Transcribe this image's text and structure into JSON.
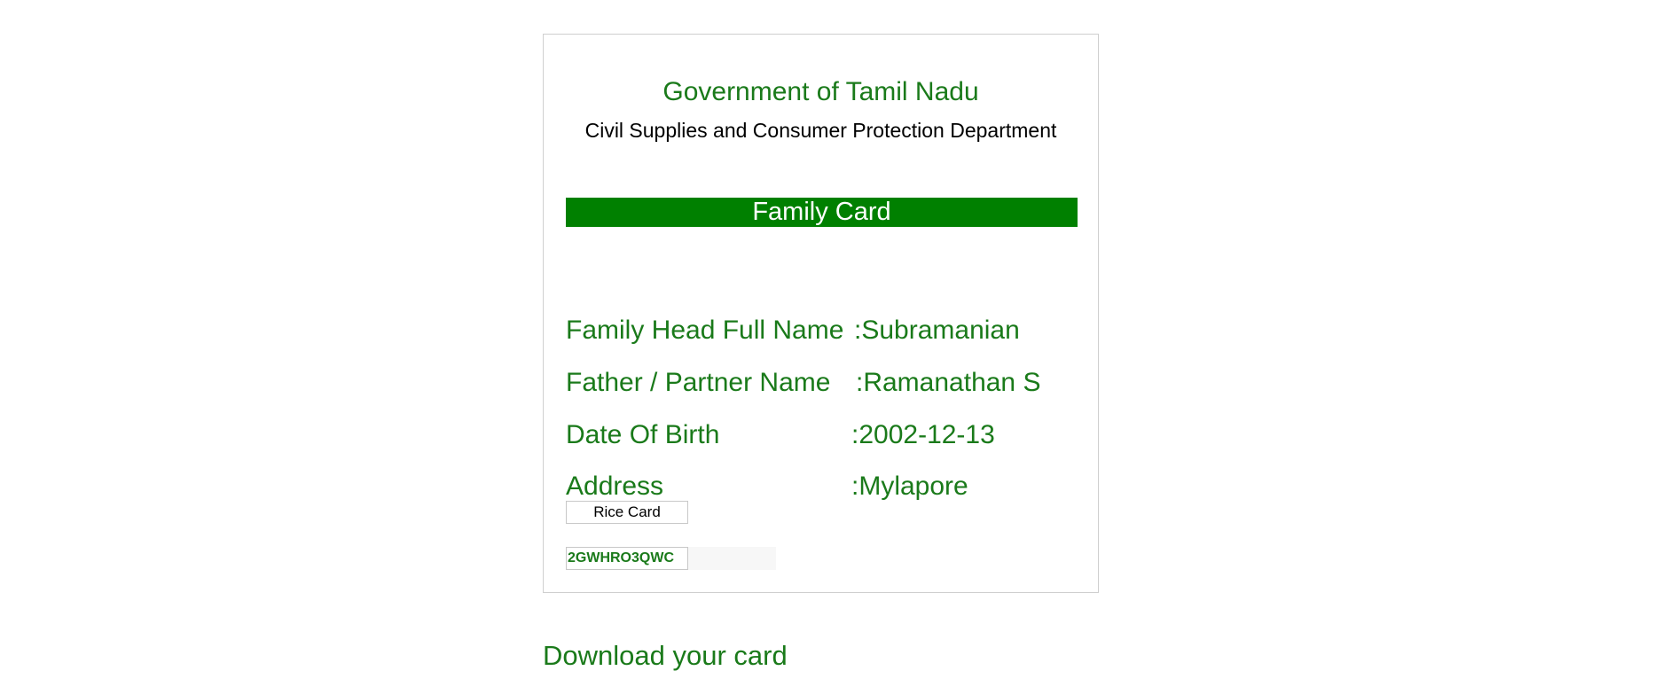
{
  "card": {
    "government_title": "Government of Tamil Nadu",
    "department_title": "Civil Supplies and Consumer Protection Department",
    "banner_title": "Family Card",
    "fields": [
      {
        "label": "Family Head Full Name",
        "value": ":Subramanian"
      },
      {
        "label": "Father / Partner Name",
        "value": ":Ramanathan S"
      },
      {
        "label": "Date Of Birth",
        "value": ":2002-12-13"
      },
      {
        "label": "Address",
        "value": ":Mylapore"
      }
    ],
    "card_type_button": "Rice Card",
    "card_code": "2GWHRO3QWC"
  },
  "download": {
    "label": "Download your card"
  },
  "colors": {
    "brand_green": "#008000",
    "text_green": "#1a7a1a"
  }
}
